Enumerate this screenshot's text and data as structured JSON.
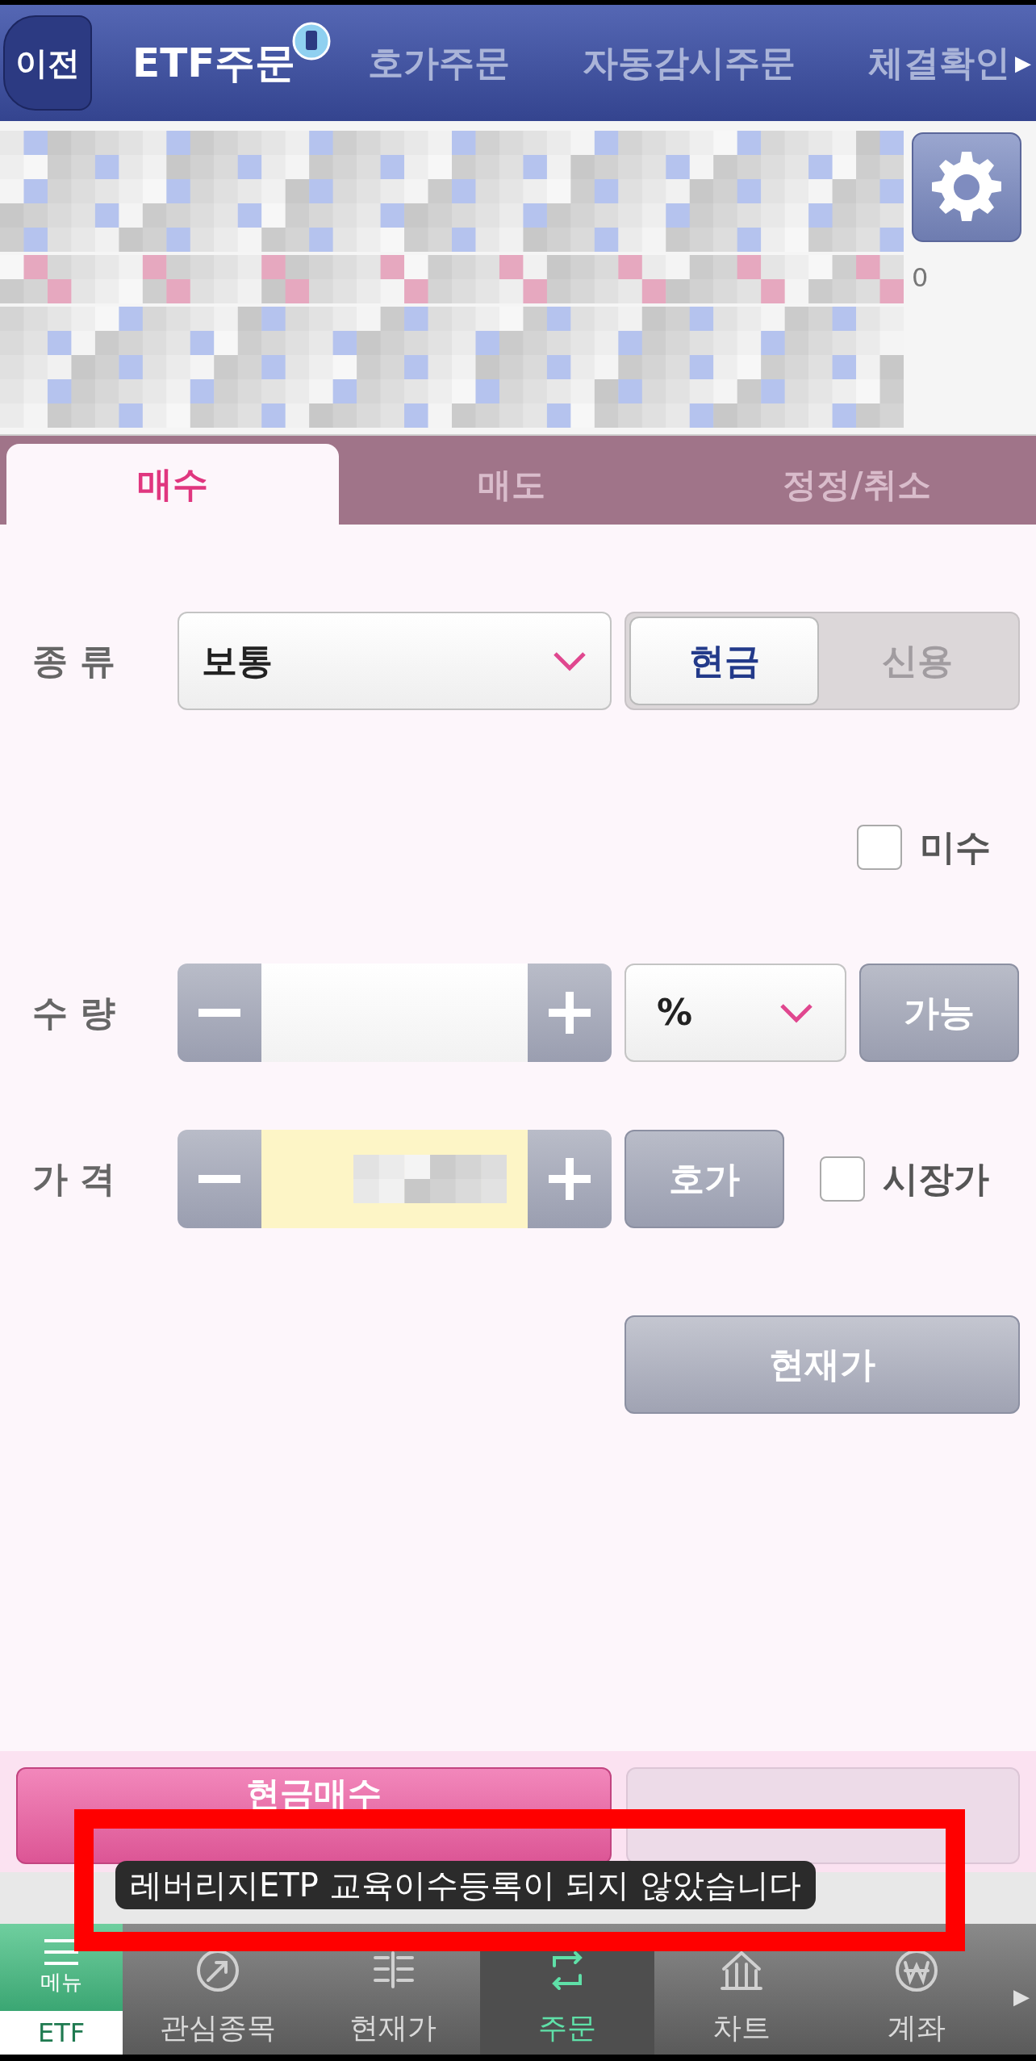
{
  "header": {
    "back": "이전",
    "more": "▶",
    "tabs": [
      {
        "label": "ETF주문",
        "selected": true
      },
      {
        "label": "호가주문",
        "selected": false
      },
      {
        "label": "자동감시주문",
        "selected": false
      },
      {
        "label": "체결확인",
        "selected": false
      }
    ]
  },
  "account": {
    "trailing": "0"
  },
  "order_tabs": [
    {
      "label": "매수",
      "selected": true
    },
    {
      "label": "매도",
      "selected": false
    },
    {
      "label": "정정/취소",
      "selected": false
    }
  ],
  "form": {
    "type": {
      "label": "종 류",
      "value": "보통"
    },
    "credit": [
      {
        "label": "현금",
        "selected": true
      },
      {
        "label": "신용",
        "selected": false
      }
    ],
    "misu": {
      "label": "미수",
      "checked": false
    },
    "quantity": {
      "label": "수 량",
      "unit": "%",
      "available": "가능"
    },
    "price": {
      "label": "가 격",
      "quote": "호가",
      "market": {
        "label": "시장가",
        "checked": false
      }
    },
    "current_price": "현재가"
  },
  "actions": {
    "buy": "현금매수"
  },
  "toast": "레버리지ETP 교육이수등록이 되지 않았습니다",
  "bottom_nav": {
    "menu": "메뉴",
    "badge": "ETF",
    "more": "▶",
    "items": [
      {
        "label": "관심종목",
        "selected": false
      },
      {
        "label": "현재가",
        "selected": false
      },
      {
        "label": "주문",
        "selected": true
      },
      {
        "label": "차트",
        "selected": false
      },
      {
        "label": "계좌",
        "selected": false
      }
    ]
  }
}
